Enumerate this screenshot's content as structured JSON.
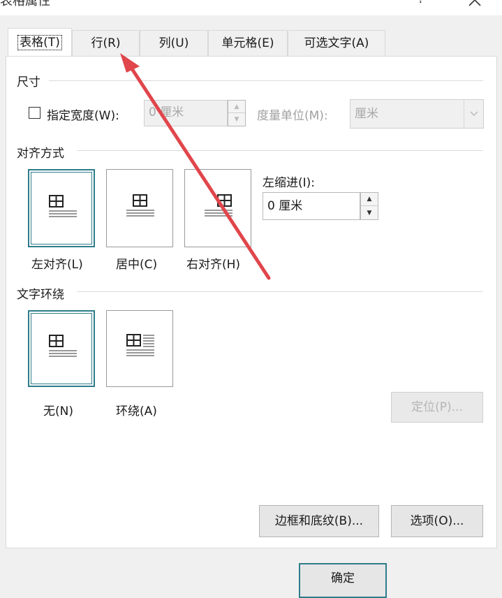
{
  "window": {
    "title": "表格属性",
    "help": "?"
  },
  "tabs": [
    {
      "label": "表格(T)",
      "active": true
    },
    {
      "label": "行(R)"
    },
    {
      "label": "列(U)"
    },
    {
      "label": "单元格(E)"
    },
    {
      "label": "可选文字(A)"
    }
  ],
  "size": {
    "section": "尺寸",
    "specify_width_label": "指定宽度(W):",
    "width_value": "0 厘米",
    "unit_label": "度量单位(M):",
    "unit_value": "厘米"
  },
  "alignment": {
    "section": "对齐方式",
    "options": [
      {
        "label": "左对齐(L)"
      },
      {
        "label": "居中(C)"
      },
      {
        "label": "右对齐(H)"
      }
    ],
    "indent_label": "左缩进(I):",
    "indent_value": "0 厘米"
  },
  "wrapping": {
    "section": "文字环绕",
    "options": [
      {
        "label": "无(N)"
      },
      {
        "label": "环绕(A)"
      }
    ],
    "position_button": "定位(P)..."
  },
  "buttons": {
    "borders_shading": "边框和底纹(B)...",
    "options": "选项(O)...",
    "ok": "确定"
  },
  "colors": {
    "selection": "#2e7c8a",
    "annotation_arrow": "#e0464b"
  }
}
